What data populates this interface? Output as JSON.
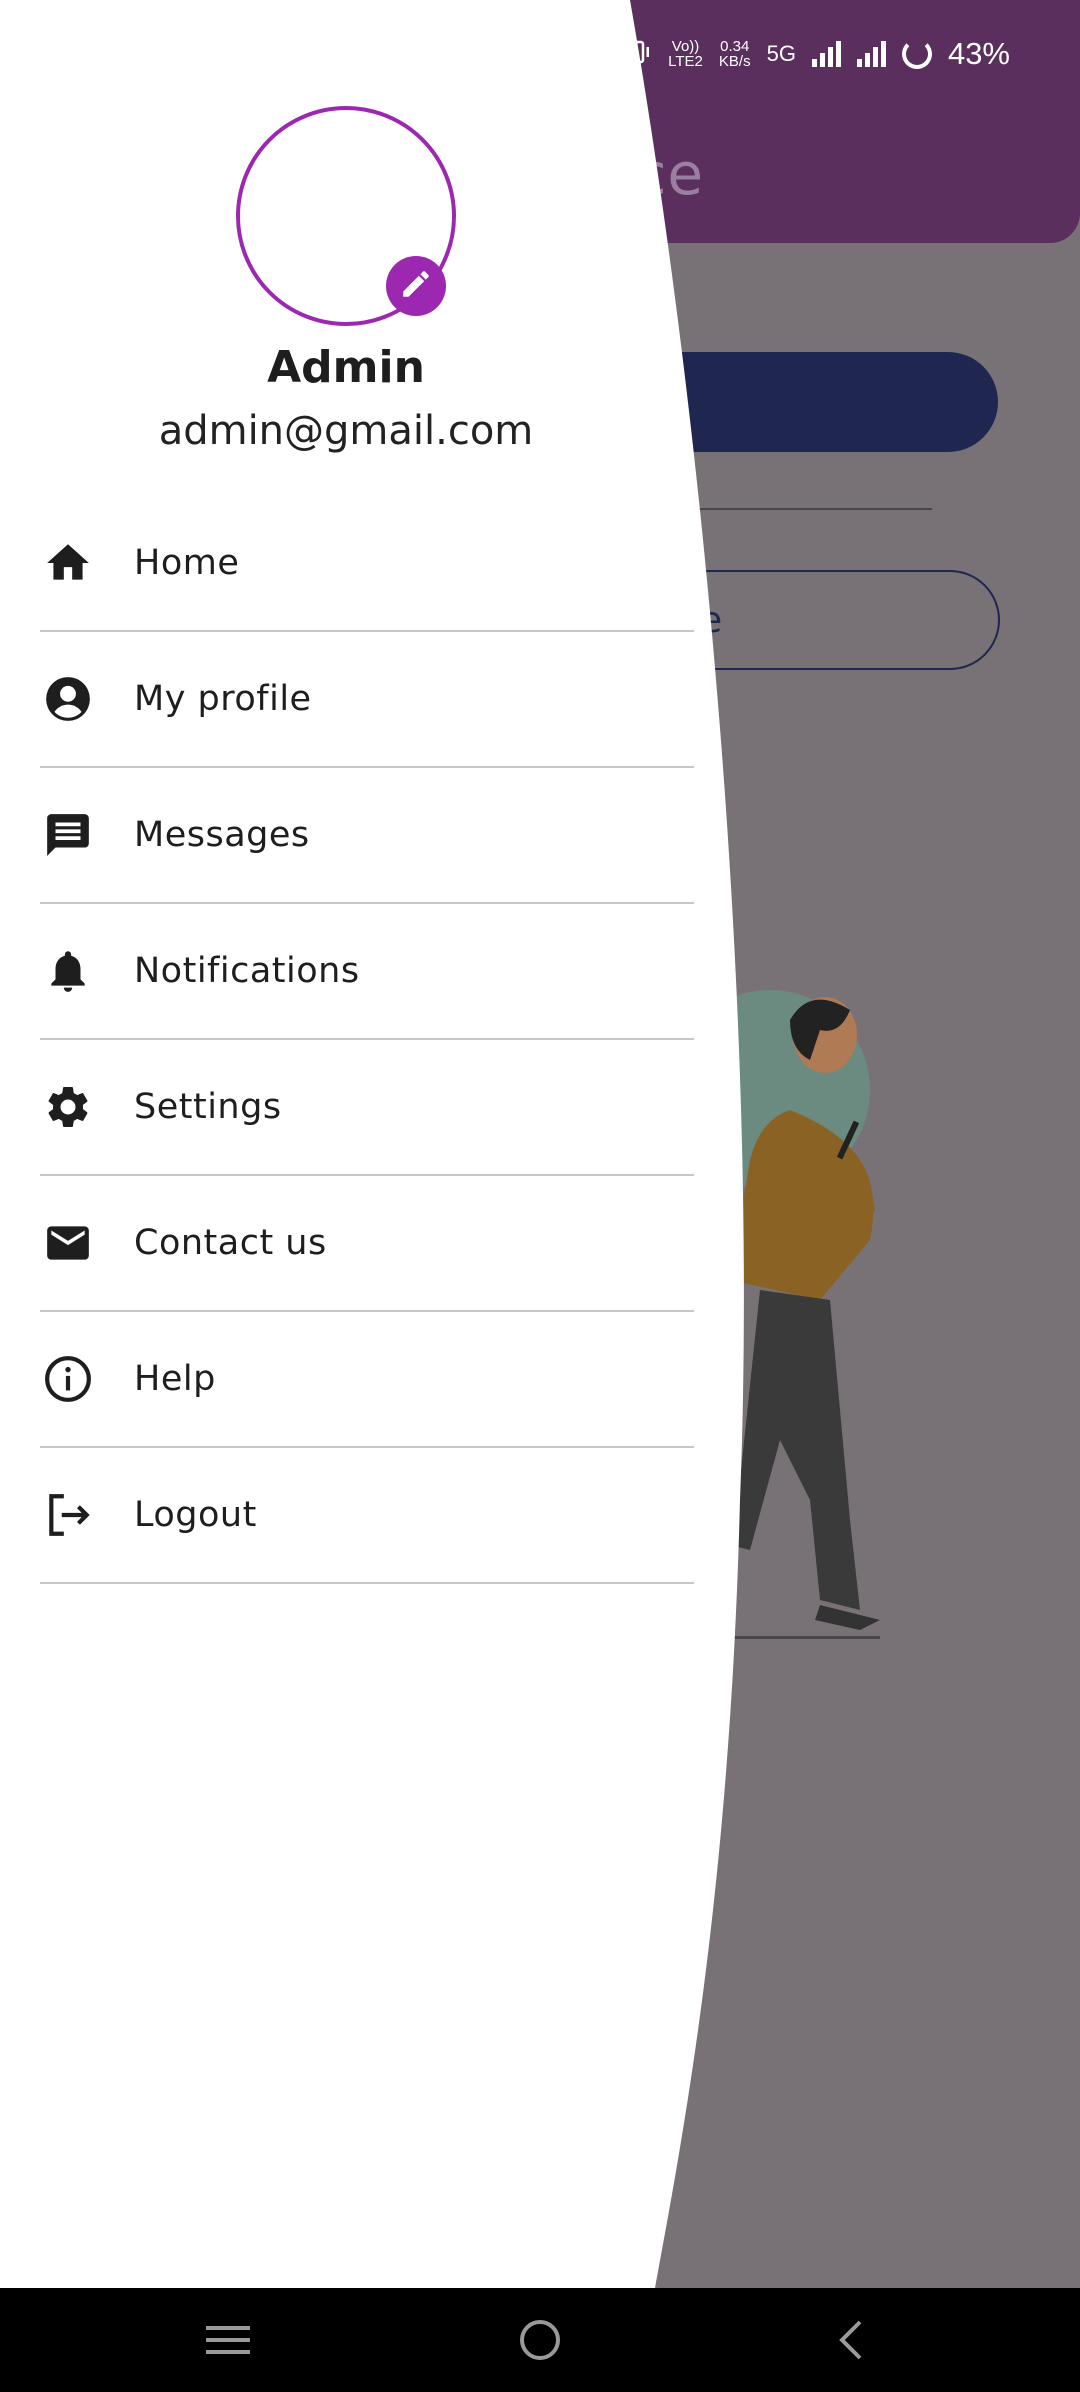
{
  "background_app": {
    "title_fragment": "ence",
    "outline_button_fragment": "e"
  },
  "status_bar": {
    "volte": "Vo))",
    "lte": "LTE2",
    "net_speed_value": "0.34",
    "net_speed_unit": "KB/s",
    "network": "5G",
    "battery": "43%"
  },
  "drawer": {
    "user": {
      "name": "Admin",
      "email": "admin@gmail.com"
    },
    "menu": [
      {
        "label": "Home",
        "icon": "home-icon"
      },
      {
        "label": "My profile",
        "icon": "account-circle-icon"
      },
      {
        "label": "Messages",
        "icon": "message-icon"
      },
      {
        "label": "Notifications",
        "icon": "bell-icon"
      },
      {
        "label": "Settings",
        "icon": "gear-icon"
      },
      {
        "label": "Contact us",
        "icon": "mail-icon"
      },
      {
        "label": "Help",
        "icon": "info-icon"
      },
      {
        "label": "Logout",
        "icon": "logout-icon"
      }
    ]
  },
  "colors": {
    "accent": "#9c27b0",
    "header": "#5a2f5e",
    "primary_button": "#1f2650",
    "scrim": "#787276"
  },
  "navbar": {
    "buttons": [
      "menu-icon",
      "home-circle-icon",
      "back-icon"
    ]
  }
}
